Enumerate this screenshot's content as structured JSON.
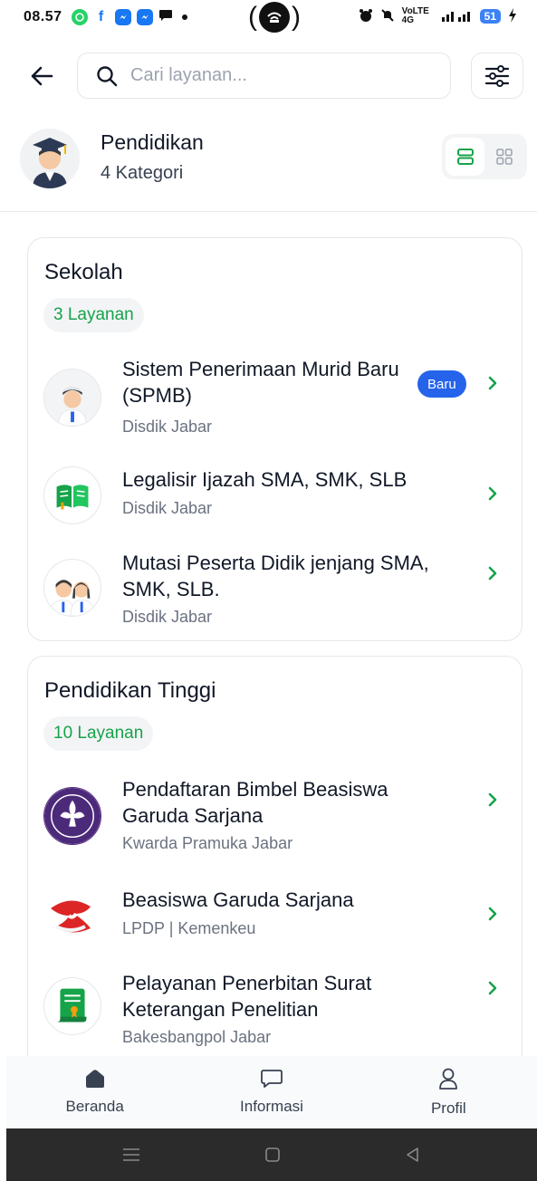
{
  "status_bar": {
    "time": "08.57",
    "apps": [
      "whatsapp-icon",
      "facebook-icon",
      "messenger-icon",
      "messenger-icon",
      "chat-icon"
    ],
    "right_text": "VoLTE 4G",
    "battery": "51"
  },
  "header": {
    "search_placeholder": "Cari layanan..."
  },
  "category": {
    "title": "Pendidikan",
    "subtitle": "4 Kategori"
  },
  "sections": [
    {
      "title": "Sekolah",
      "count": "3 Layanan",
      "items": [
        {
          "name": "Sistem Penerimaan Murid Baru (SPMB)",
          "org": "Disdik Jabar",
          "badge": "Baru",
          "icon": "student-boy-icon"
        },
        {
          "name": "Legalisir Ijazah SMA, SMK, SLB",
          "org": "Disdik Jabar",
          "icon": "book-icon"
        },
        {
          "name": "Mutasi Peserta Didik jenjang SMA, SMK, SLB.",
          "org": "Disdik Jabar",
          "icon": "students-icon"
        }
      ]
    },
    {
      "title": "Pendidikan Tinggi",
      "count": "10 Layanan",
      "items": [
        {
          "name": "Pendaftaran Bimbel Beasiswa Garuda Sarjana",
          "org": "Kwarda Pramuka Jabar",
          "icon": "scout-emblem-icon"
        },
        {
          "name": "Beasiswa Garuda Sarjana",
          "org": "LPDP | Kemenkeu",
          "icon": "ribbon-icon"
        },
        {
          "name": "Pelayanan Penerbitan Surat Keterangan Penelitian",
          "org": "Bakesbangpol Jabar",
          "icon": "certificate-icon"
        }
      ]
    }
  ],
  "bottom_nav": {
    "items": [
      {
        "label": "Beranda",
        "icon": "home-icon"
      },
      {
        "label": "Informasi",
        "icon": "message-icon"
      },
      {
        "label": "Profil",
        "icon": "user-icon"
      }
    ]
  },
  "colors": {
    "accent_green": "#16a34a",
    "badge_blue": "#2563eb"
  }
}
